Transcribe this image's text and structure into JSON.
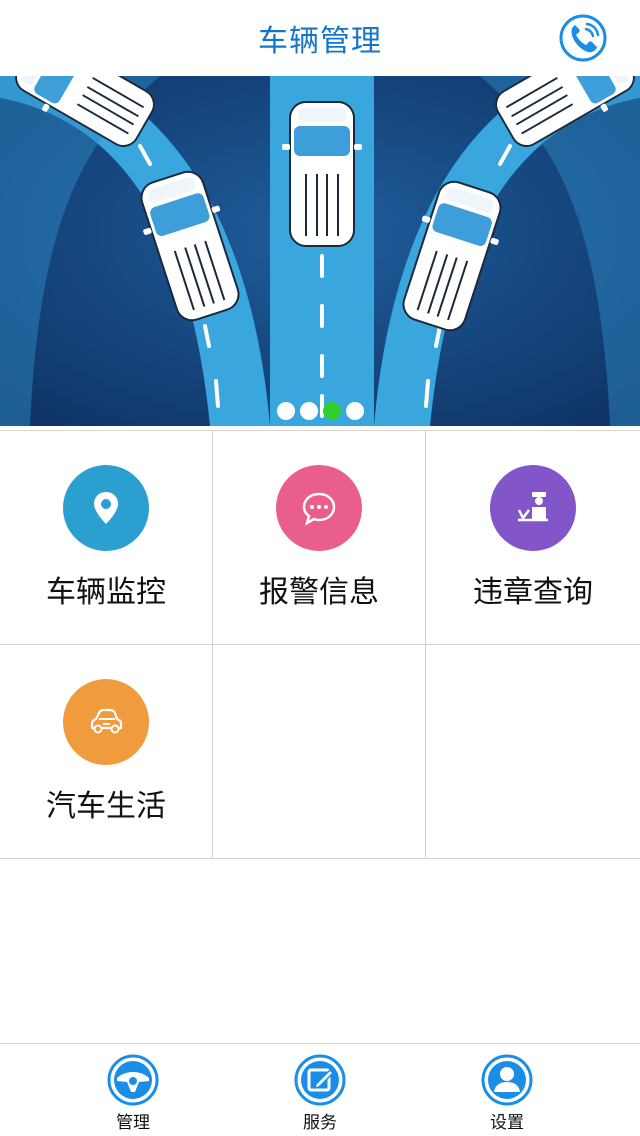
{
  "header": {
    "title": "车辆管理",
    "phone_icon": "phone-icon"
  },
  "banner": {
    "slides": 4,
    "active_slide_index": 2,
    "accent_colors": {
      "active_dot": "#2fcf2f",
      "road": "#3aa6de",
      "background": "#16487f"
    }
  },
  "grid": {
    "items": [
      {
        "label": "车辆监控",
        "icon": "location-pin-icon",
        "color": "#2a9fd0"
      },
      {
        "label": "报警信息",
        "icon": "chat-bubble-icon",
        "color": "#ea5e8d"
      },
      {
        "label": "违章查询",
        "icon": "traffic-police-icon",
        "color": "#8255c8"
      },
      {
        "label": "汽车生活",
        "icon": "car-icon",
        "color": "#f09c3e"
      }
    ]
  },
  "tabbar": {
    "items": [
      {
        "label": "管理",
        "icon": "steering-wheel-icon"
      },
      {
        "label": "服务",
        "icon": "edit-icon"
      },
      {
        "label": "设置",
        "icon": "user-icon"
      }
    ],
    "accent": "#1a8ee6"
  }
}
